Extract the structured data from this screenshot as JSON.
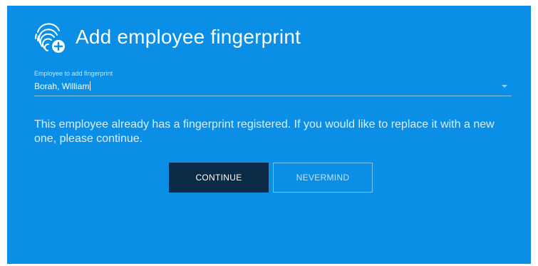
{
  "dialog": {
    "title": "Add employee fingerprint",
    "icon": "fingerprint-add-icon",
    "background_color": "#0b8fe6"
  },
  "employee_field": {
    "label": "Employee to add fingerprint",
    "value": "Borah, William"
  },
  "message": "This employee already has a fingerprint registered. If you would like to replace it with a new one, please continue.",
  "buttons": {
    "continue_label": "CONTINUE",
    "nevermind_label": "NEVERMIND"
  }
}
